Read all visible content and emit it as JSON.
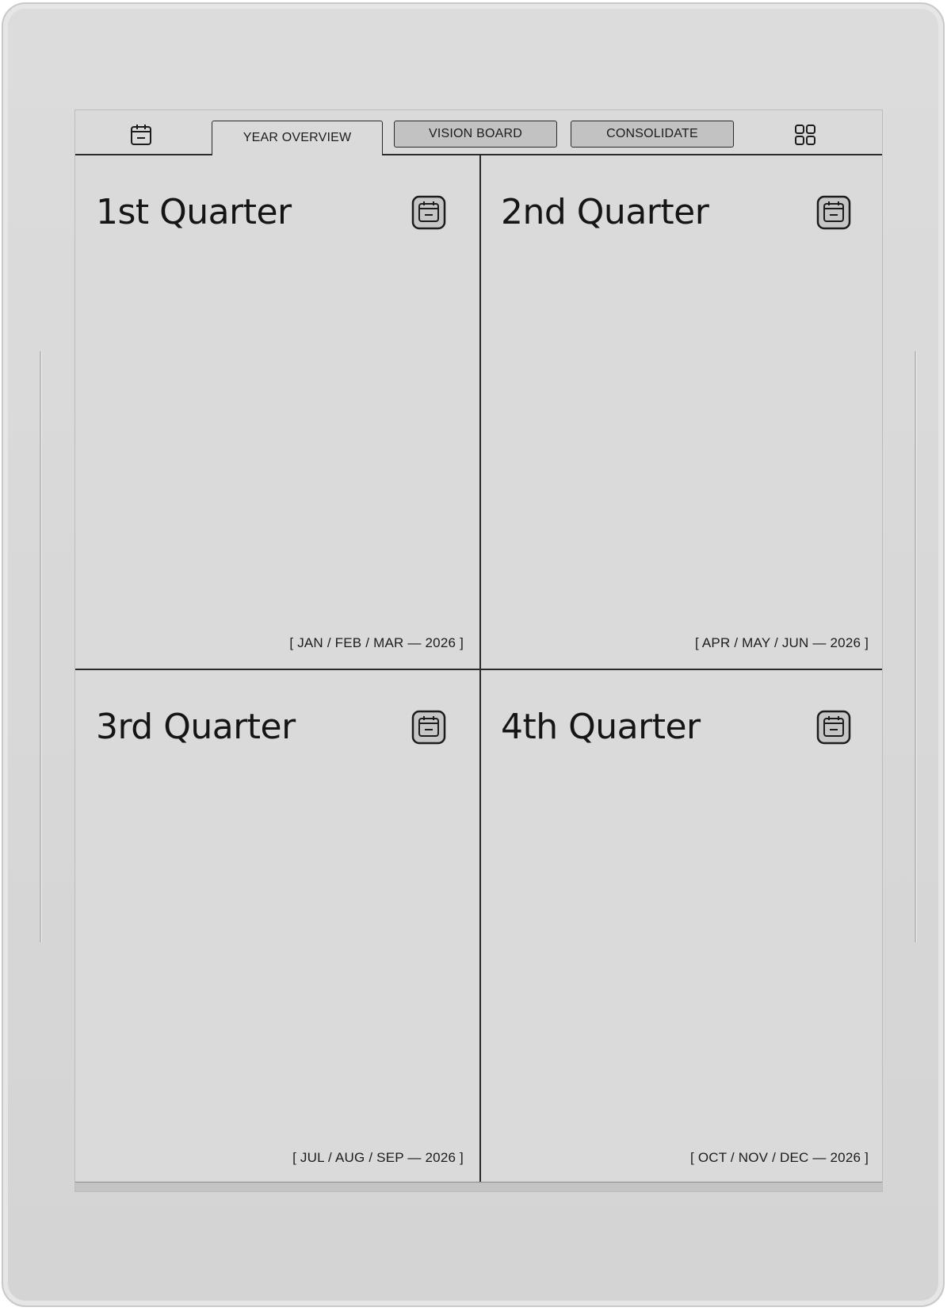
{
  "nav": {
    "tabs": [
      {
        "label": "YEAR OVERVIEW",
        "active": true
      },
      {
        "label": "VISION BOARD",
        "active": false
      },
      {
        "label": "CONSOLIDATE",
        "active": false
      }
    ],
    "left_icon": "calendar-icon",
    "right_icon": "grid-icon"
  },
  "quarters": [
    {
      "title": "1st Quarter",
      "range": "[ JAN / FEB / MAR — 2026 ]",
      "icon": "calendar-icon"
    },
    {
      "title": "2nd Quarter",
      "range": "[ APR / MAY / JUN — 2026 ]",
      "icon": "calendar-icon"
    },
    {
      "title": "3rd Quarter",
      "range": "[ JUL / AUG / SEP — 2026 ]",
      "icon": "calendar-icon"
    },
    {
      "title": "4th Quarter",
      "range": "[ OCT / NOV / DEC — 2026 ]",
      "icon": "calendar-icon"
    }
  ],
  "colors": {
    "screen": "#dadada",
    "ink": "#1c1c1c",
    "inactive_tab": "#c2c2c2",
    "bezel": "#d8d8d8"
  }
}
